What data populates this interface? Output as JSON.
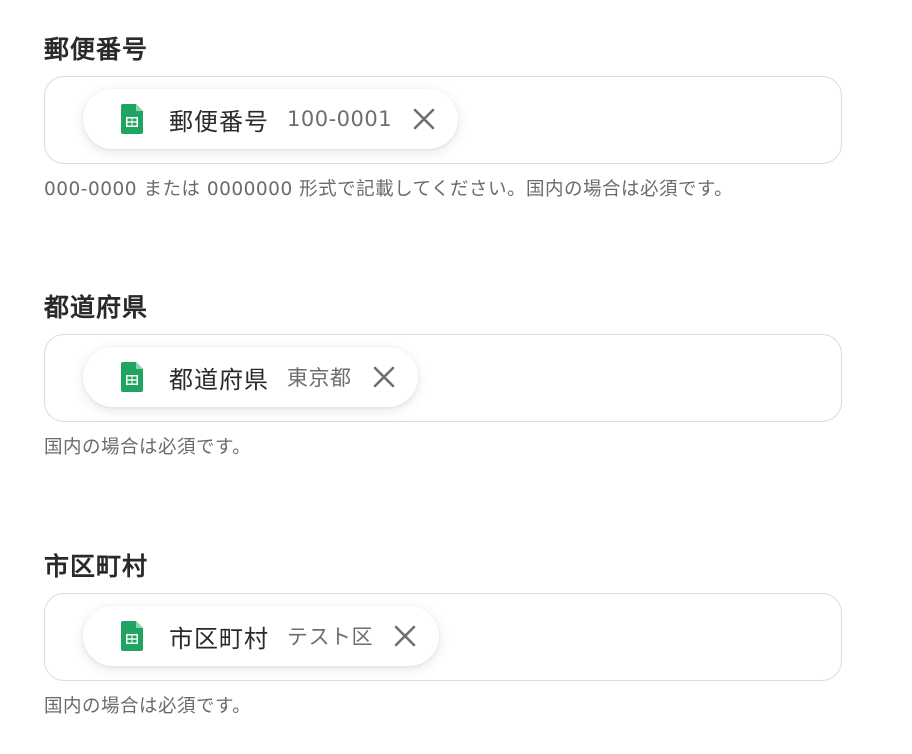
{
  "fields": [
    {
      "label": "郵便番号",
      "chip": {
        "icon": "google-sheets-icon",
        "name": "郵便番号",
        "value": "100-0001"
      },
      "help": "000-0000 または 0000000 形式で記載してください。国内の場合は必須です。"
    },
    {
      "label": "都道府県",
      "chip": {
        "icon": "google-sheets-icon",
        "name": "都道府県",
        "value": "東京都"
      },
      "help": "国内の場合は必須です。"
    },
    {
      "label": "市区町村",
      "chip": {
        "icon": "google-sheets-icon",
        "name": "市区町村",
        "value": "テスト区"
      },
      "help": "国内の場合は必須です。"
    }
  ],
  "colors": {
    "sheets_green": "#1fa463",
    "border": "#dcdcdc",
    "help_text": "#6b6b6b",
    "close_icon": "#707070"
  }
}
